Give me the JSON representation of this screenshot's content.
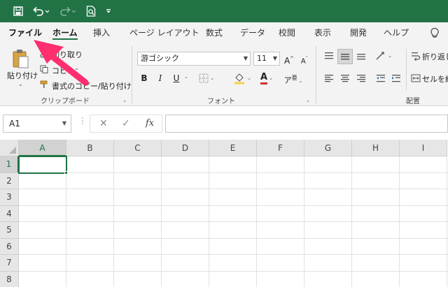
{
  "qat": {
    "icons": [
      "save-icon",
      "undo-icon",
      "redo-icon",
      "print-preview-icon",
      "customize-qat-icon"
    ]
  },
  "tabs": [
    {
      "label": "ファイル"
    },
    {
      "label": "ホーム"
    },
    {
      "label": "挿入"
    },
    {
      "label": "ページ レイアウト"
    },
    {
      "label": "数式"
    },
    {
      "label": "データ"
    },
    {
      "label": "校閲"
    },
    {
      "label": "表示"
    },
    {
      "label": "開発"
    },
    {
      "label": "ヘルプ"
    }
  ],
  "ribbon": {
    "clipboard": {
      "paste_label": "貼り付け",
      "cut_label": "切り取り",
      "copy_label": "コピー",
      "format_painter_label": "書式のコピー/貼り付け",
      "group_label": "クリップボード"
    },
    "font": {
      "font_name": "游ゴシック",
      "font_size": "11",
      "bold_label": "B",
      "italic_label": "I",
      "underline_label": "U",
      "increase_label": "A",
      "decrease_label": "A",
      "font_color_label": "A",
      "phonetic_label": "ア",
      "group_label": "フォント"
    },
    "alignment": {
      "wrap_label": "折り返し",
      "merge_label": "セルを結",
      "group_label": "配置"
    }
  },
  "formula_bar": {
    "name_box": "A1",
    "fx_label": "fx",
    "formula": ""
  },
  "grid": {
    "columns": [
      "A",
      "B",
      "C",
      "D",
      "E",
      "F",
      "G",
      "H",
      "I"
    ],
    "rows": [
      "1",
      "2",
      "3",
      "4",
      "5",
      "6",
      "7",
      "8"
    ]
  },
  "colors": {
    "accent": "#217346",
    "annotation_arrow": "#ff2e6e"
  }
}
